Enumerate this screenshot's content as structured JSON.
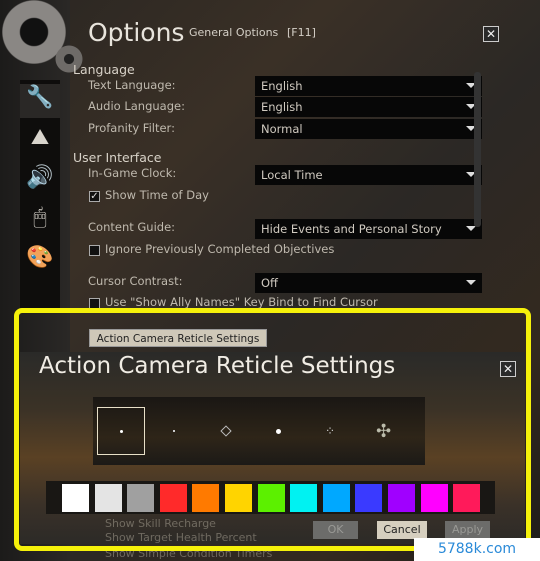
{
  "window": {
    "title": "Options",
    "subtitle": "General Options",
    "hotkey": "[F11]",
    "close": "✕"
  },
  "sidebar": {
    "icons": [
      "wrench-icon",
      "mountains-icon",
      "speaker-icon",
      "mouse-icon",
      "palette-icon"
    ],
    "selected": 0
  },
  "language": {
    "heading": "Language",
    "rows": [
      {
        "label": "Text Language:",
        "value": "English"
      },
      {
        "label": "Audio Language:",
        "value": "English"
      },
      {
        "label": "Profanity Filter:",
        "value": "Normal"
      }
    ]
  },
  "ui": {
    "heading": "User Interface",
    "clock": {
      "label": "In-Game Clock:",
      "value": "Local Time"
    },
    "show_time": {
      "label": "Show Time of Day",
      "checked": true
    },
    "content_guide": {
      "label": "Content Guide:",
      "value": "Hide Events and Personal Story"
    },
    "ignore": {
      "label": "Ignore Previously Completed Objectives",
      "checked": false
    },
    "cursor": {
      "label": "Cursor Contrast:",
      "value": "Off"
    },
    "ally": {
      "label": "Use \"Show Ally Names\" Key Bind to Find Cursor",
      "checked": false
    },
    "reticle_button": "Action Camera Reticle Settings",
    "below": [
      {
        "label": "Show Skill Recharge",
        "checked": true
      },
      {
        "label": "Show Target Health Percent",
        "checked": true
      },
      {
        "label": "Show Simple Condition Timers",
        "checked": false
      }
    ]
  },
  "dialog": {
    "title": "Action Camera Reticle Settings",
    "close": "✕",
    "reticles": [
      "dot",
      "small-dot",
      "diamond",
      "large-dot",
      "four-corners",
      "four-petals"
    ],
    "selected_reticle": 0,
    "colors": [
      "#ffffff",
      "#e4e4e4",
      "#a0a0a0",
      "#ff2a2a",
      "#ff7a00",
      "#ffd400",
      "#5cf000",
      "#00f2f2",
      "#00a8ff",
      "#3a3aff",
      "#a000ff",
      "#ff00ff",
      "#ff1a5a"
    ],
    "ok": "OK",
    "cancel": "Cancel",
    "apply": "Apply"
  },
  "highlight_color": "#f5f10a",
  "watermark": "5788k.com"
}
